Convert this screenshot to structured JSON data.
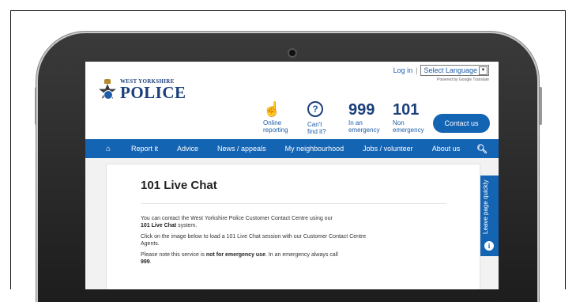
{
  "header": {
    "login": "Log in",
    "separator": "|",
    "language_select": "Select Language",
    "powered_by": "Powered by Google Translate",
    "logo_small": "WEST YORKSHIRE",
    "logo_big": "POLICE"
  },
  "quick_links": [
    {
      "line1": "Online",
      "line2": "reporting",
      "icon": "hand-pointer-icon"
    },
    {
      "line1": "Can't",
      "line2": "find it?",
      "icon": "question-circle-icon"
    },
    {
      "number": "999",
      "line1": "In an",
      "line2": "emergency"
    },
    {
      "number": "101",
      "line1": "Non",
      "line2": "emergency"
    }
  ],
  "contact_button": "Contact us",
  "nav": {
    "items": [
      "Report it",
      "Advice",
      "News / appeals",
      "My neighbourhood",
      "Jobs / volunteer",
      "About us"
    ]
  },
  "page": {
    "title": "101 Live Chat",
    "para1_text": "You can contact the West Yorkshire Police Customer Contact Centre using our",
    "para1_bold": "101 Live Chat",
    "para1_end": "system.",
    "para2": "Click on the image below to load a 101 Live Chat session with our Customer Contact Centre Agents.",
    "para3_text": "Please note this service is",
    "para3_bold": "not for emergency use",
    "para3_mid": ". In an emergency always call",
    "para3_bold2": "999",
    "para3_end": "."
  },
  "leave_tab": "Leave page quickly",
  "colors": {
    "brand_blue": "#1464b4",
    "navy": "#1b3f7a",
    "chat_button": "#29b7e8"
  }
}
